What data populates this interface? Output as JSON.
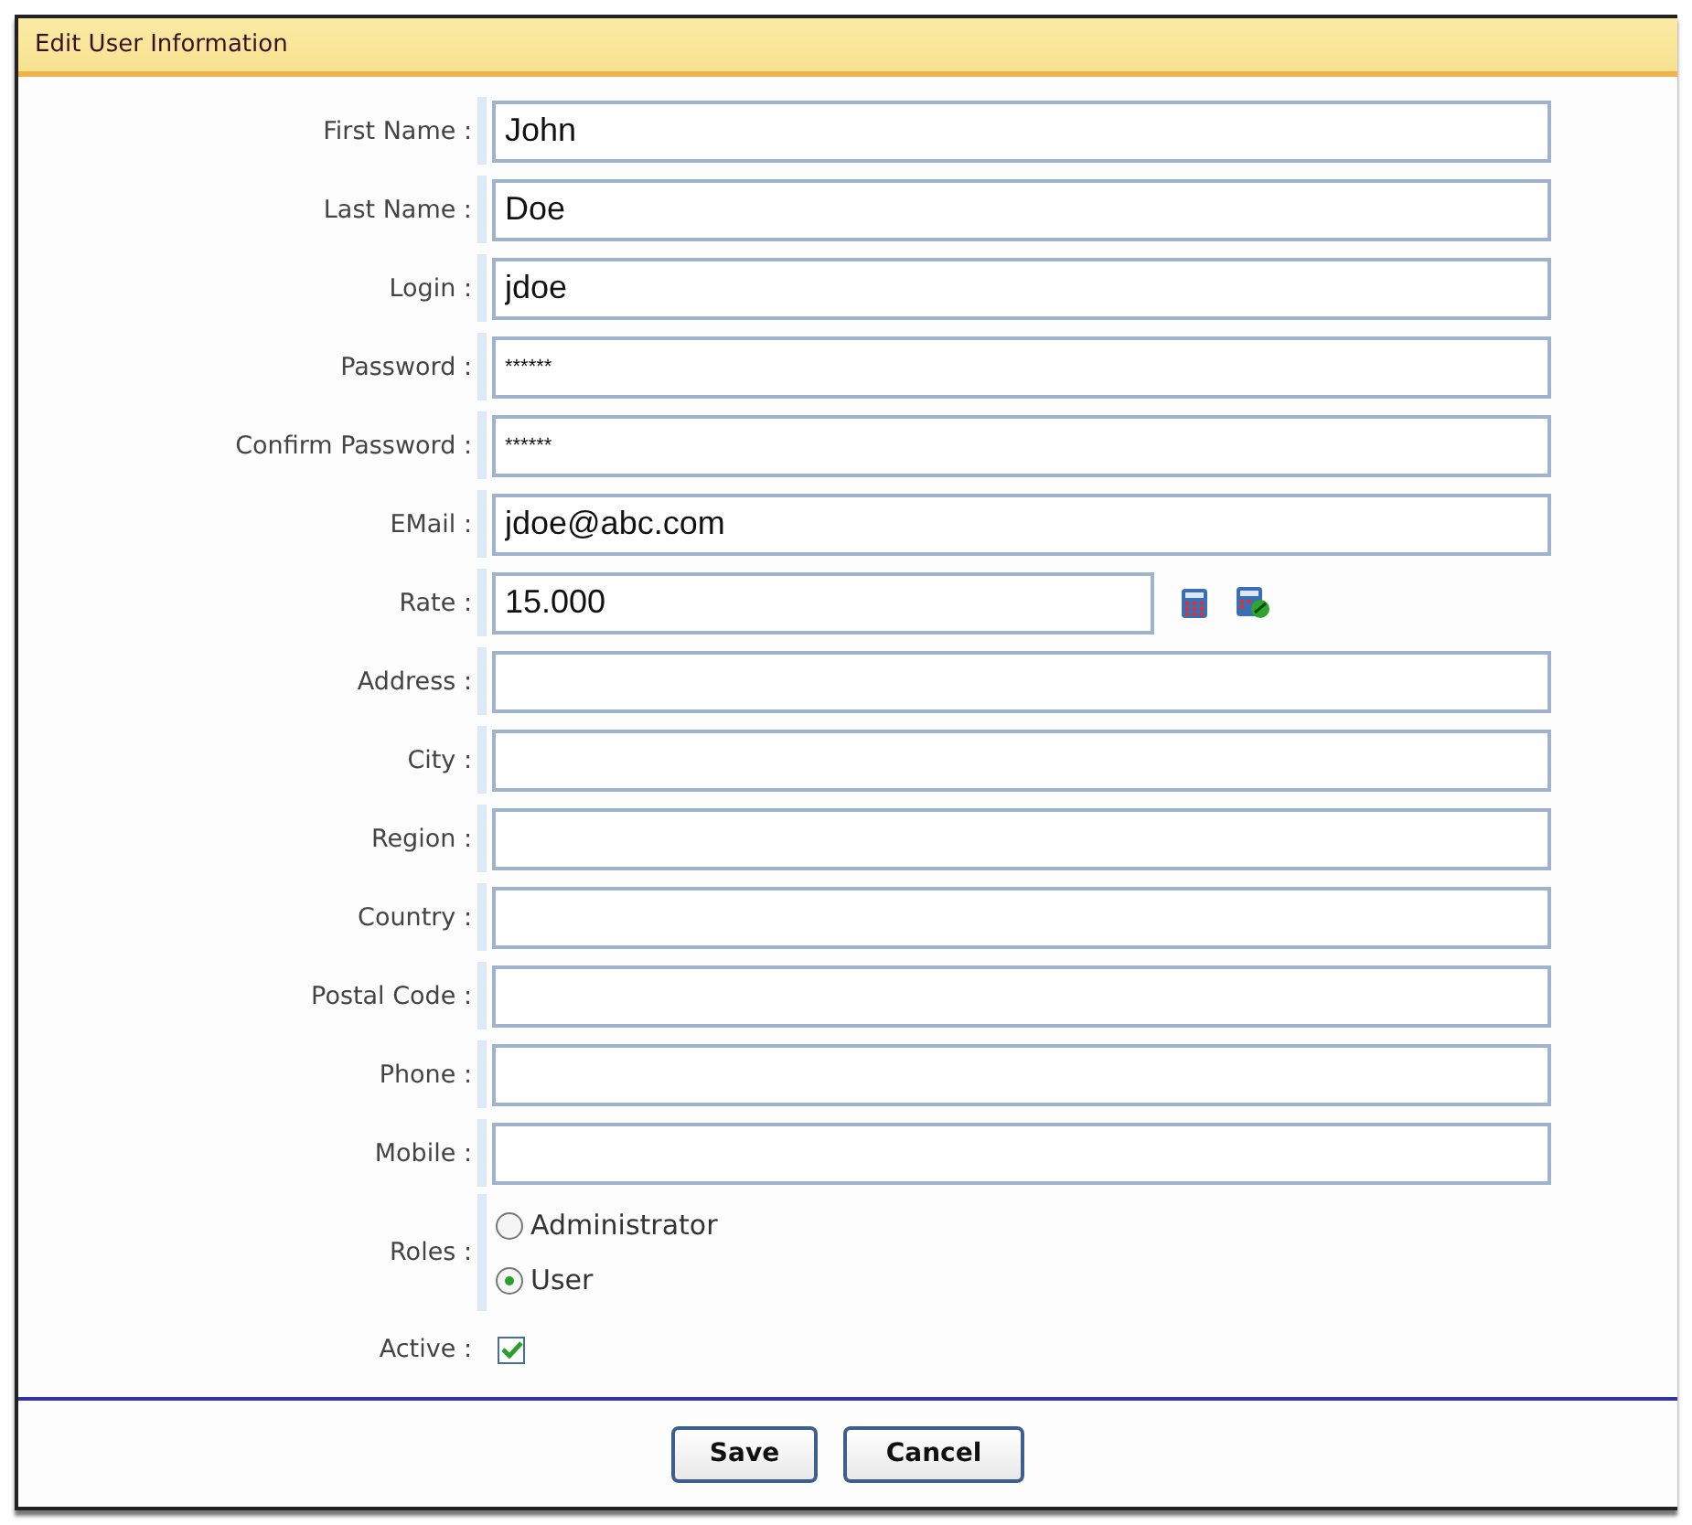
{
  "panel": {
    "title": "Edit User Information"
  },
  "fields": [
    {
      "label": "First Name :",
      "kind": "text",
      "value": "John"
    },
    {
      "label": "Last Name :",
      "kind": "text",
      "value": "Doe"
    },
    {
      "label": "Login :",
      "kind": "text",
      "value": "jdoe"
    },
    {
      "label": "Password :",
      "kind": "password",
      "value": "******"
    },
    {
      "label": "Confirm Password :",
      "kind": "password",
      "value": "******"
    },
    {
      "label": "EMail :",
      "kind": "text",
      "value": "jdoe@abc.com"
    },
    {
      "label": "Rate :",
      "kind": "rate",
      "value": "15.000"
    },
    {
      "label": "Address :",
      "kind": "text"
    },
    {
      "label": "City :",
      "kind": "text"
    },
    {
      "label": "Region :",
      "kind": "text"
    },
    {
      "label": "Country :",
      "kind": "text"
    },
    {
      "label": "Postal Code :",
      "kind": "text"
    },
    {
      "label": "Phone :",
      "kind": "text"
    },
    {
      "label": "Mobile :",
      "kind": "text"
    }
  ],
  "roles": {
    "label": "Roles :",
    "options": [
      {
        "label": "Administrator",
        "selected": false
      },
      {
        "label": "User",
        "selected": true
      }
    ]
  },
  "active": {
    "label": "Active :",
    "checked": true
  },
  "buttons": [
    "Save",
    "Cancel"
  ]
}
